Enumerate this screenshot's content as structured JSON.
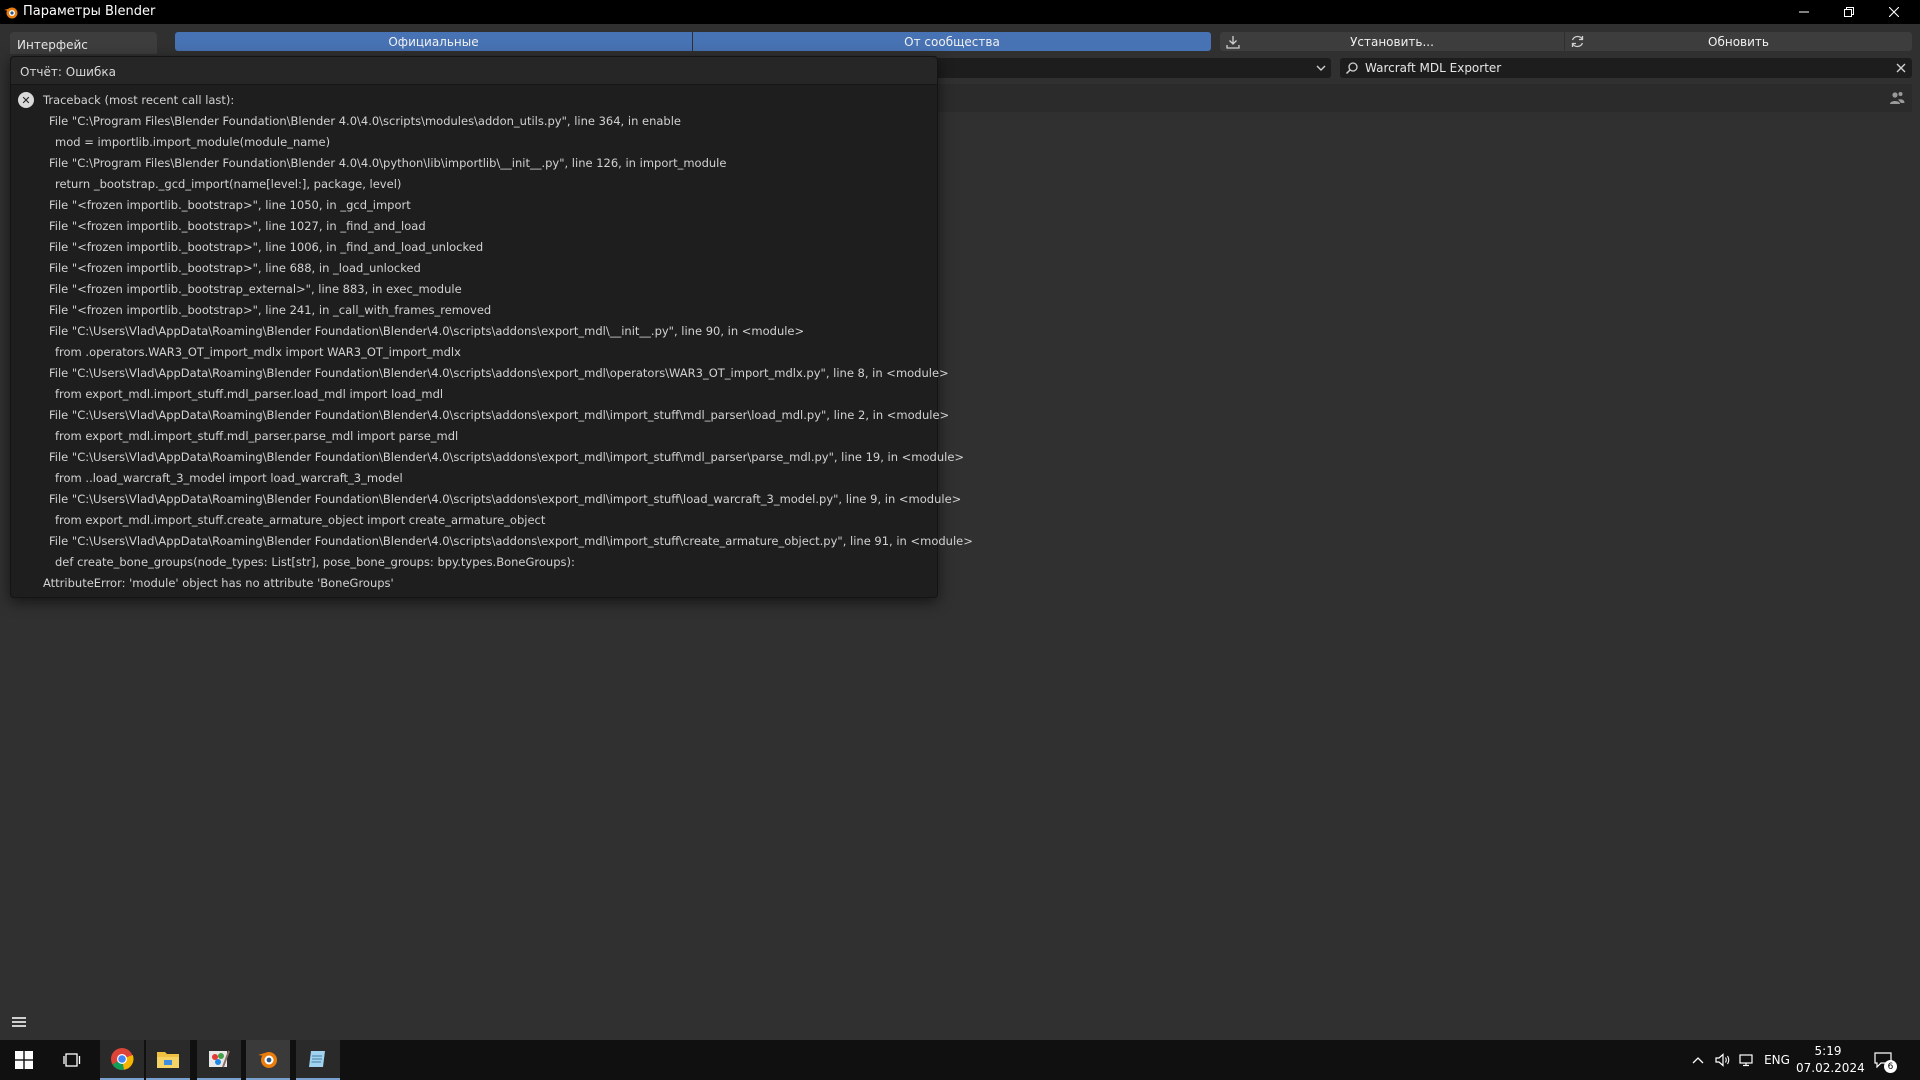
{
  "window": {
    "title": "Параметры Blender"
  },
  "sidebar": {
    "active_tab": "Интерфейс"
  },
  "header": {
    "official_label": "Официальные",
    "community_label": "От сообщества",
    "install_label": "Установить...",
    "refresh_label": "Обновить"
  },
  "search": {
    "value": "Warcraft MDL Exporter"
  },
  "report": {
    "title": "Отчёт: Ошибка",
    "lines": [
      "Traceback (most recent call last):",
      "File \"C:\\Program Files\\Blender Foundation\\Blender 4.0\\4.0\\scripts\\modules\\addon_utils.py\", line 364, in enable",
      "mod = importlib.import_module(module_name)",
      "File \"C:\\Program Files\\Blender Foundation\\Blender 4.0\\4.0\\python\\lib\\importlib\\__init__.py\", line 126, in import_module",
      "return _bootstrap._gcd_import(name[level:], package, level)",
      "File \"<frozen importlib._bootstrap>\", line 1050, in _gcd_import",
      "File \"<frozen importlib._bootstrap>\", line 1027, in _find_and_load",
      "File \"<frozen importlib._bootstrap>\", line 1006, in _find_and_load_unlocked",
      "File \"<frozen importlib._bootstrap>\", line 688, in _load_unlocked",
      "File \"<frozen importlib._bootstrap_external>\", line 883, in exec_module",
      "File \"<frozen importlib._bootstrap>\", line 241, in _call_with_frames_removed",
      "File \"C:\\Users\\Vlad\\AppData\\Roaming\\Blender Foundation\\Blender\\4.0\\scripts\\addons\\export_mdl\\__init__.py\", line 90, in <module>",
      "from .operators.WAR3_OT_import_mdlx import WAR3_OT_import_mdlx",
      "File \"C:\\Users\\Vlad\\AppData\\Roaming\\Blender Foundation\\Blender\\4.0\\scripts\\addons\\export_mdl\\operators\\WAR3_OT_import_mdlx.py\", line 8, in <module>",
      "from export_mdl.import_stuff.mdl_parser.load_mdl import load_mdl",
      "File \"C:\\Users\\Vlad\\AppData\\Roaming\\Blender Foundation\\Blender\\4.0\\scripts\\addons\\export_mdl\\import_stuff\\mdl_parser\\load_mdl.py\", line 2, in <module>",
      "from export_mdl.import_stuff.mdl_parser.parse_mdl import parse_mdl",
      "File \"C:\\Users\\Vlad\\AppData\\Roaming\\Blender Foundation\\Blender\\4.0\\scripts\\addons\\export_mdl\\import_stuff\\mdl_parser\\parse_mdl.py\", line 19, in <module>",
      "from ..load_warcraft_3_model import load_warcraft_3_model",
      "File \"C:\\Users\\Vlad\\AppData\\Roaming\\Blender Foundation\\Blender\\4.0\\scripts\\addons\\export_mdl\\import_stuff\\load_warcraft_3_model.py\", line 9, in <module>",
      "from export_mdl.import_stuff.create_armature_object import create_armature_object",
      "File \"C:\\Users\\Vlad\\AppData\\Roaming\\Blender Foundation\\Blender\\4.0\\scripts\\addons\\export_mdl\\import_stuff\\create_armature_object.py\", line 91, in <module>",
      "def create_bone_groups(node_types: List[str], pose_bone_groups: bpy.types.BoneGroups):",
      "AttributeError: 'module' object has no attribute 'BoneGroups'"
    ],
    "indent": [
      0,
      1,
      2,
      1,
      2,
      1,
      1,
      1,
      1,
      1,
      1,
      1,
      2,
      1,
      2,
      1,
      2,
      1,
      2,
      1,
      2,
      1,
      2,
      0
    ]
  },
  "taskbar": {
    "language": "ENG",
    "time": "5:19",
    "date": "07.02.2024",
    "notifications": "6"
  },
  "colors": {
    "accent": "#4772b3",
    "background": "#303030",
    "popup": "#1e1e1e",
    "taskbar": "#101010"
  }
}
